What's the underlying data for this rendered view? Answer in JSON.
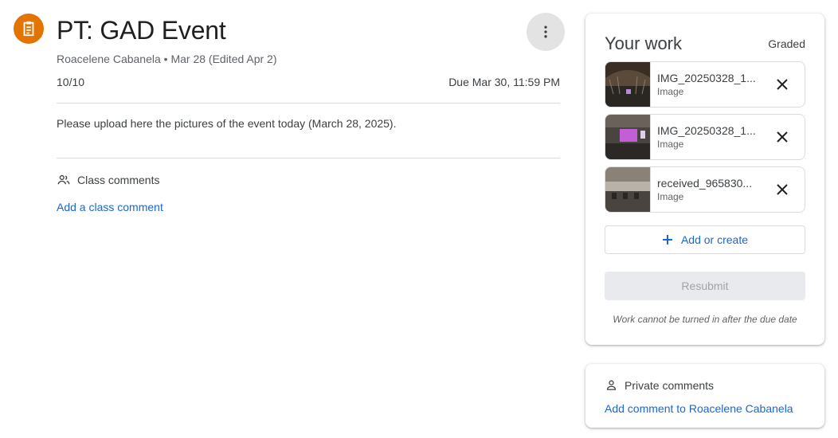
{
  "assignment": {
    "title": "PT: GAD Event",
    "meta": "Roacelene Cabanela • Mar 28 (Edited Apr 2)",
    "points": "10/10",
    "due": "Due Mar 30, 11:59 PM",
    "description": "Please upload here the pictures of the event today (March 28, 2025).",
    "class_comments_label": "Class comments",
    "add_class_comment": "Add a class comment",
    "icon": "assignment-icon",
    "accent": "#e37400"
  },
  "your_work": {
    "title": "Your work",
    "status": "Graded",
    "attachments": [
      {
        "name": "IMG_20250328_1...",
        "type": "Image"
      },
      {
        "name": "IMG_20250328_1...",
        "type": "Image"
      },
      {
        "name": "received_965830...",
        "type": "Image"
      }
    ],
    "add_or_create": "Add or create",
    "resubmit": "Resubmit",
    "note": "Work cannot be turned in after the due date"
  },
  "private_comments": {
    "label": "Private comments",
    "add_link": "Add comment to Roacelene Cabanela"
  },
  "colors": {
    "link": "#1967d2",
    "text": "#3c4043",
    "muted": "#5f6368"
  }
}
